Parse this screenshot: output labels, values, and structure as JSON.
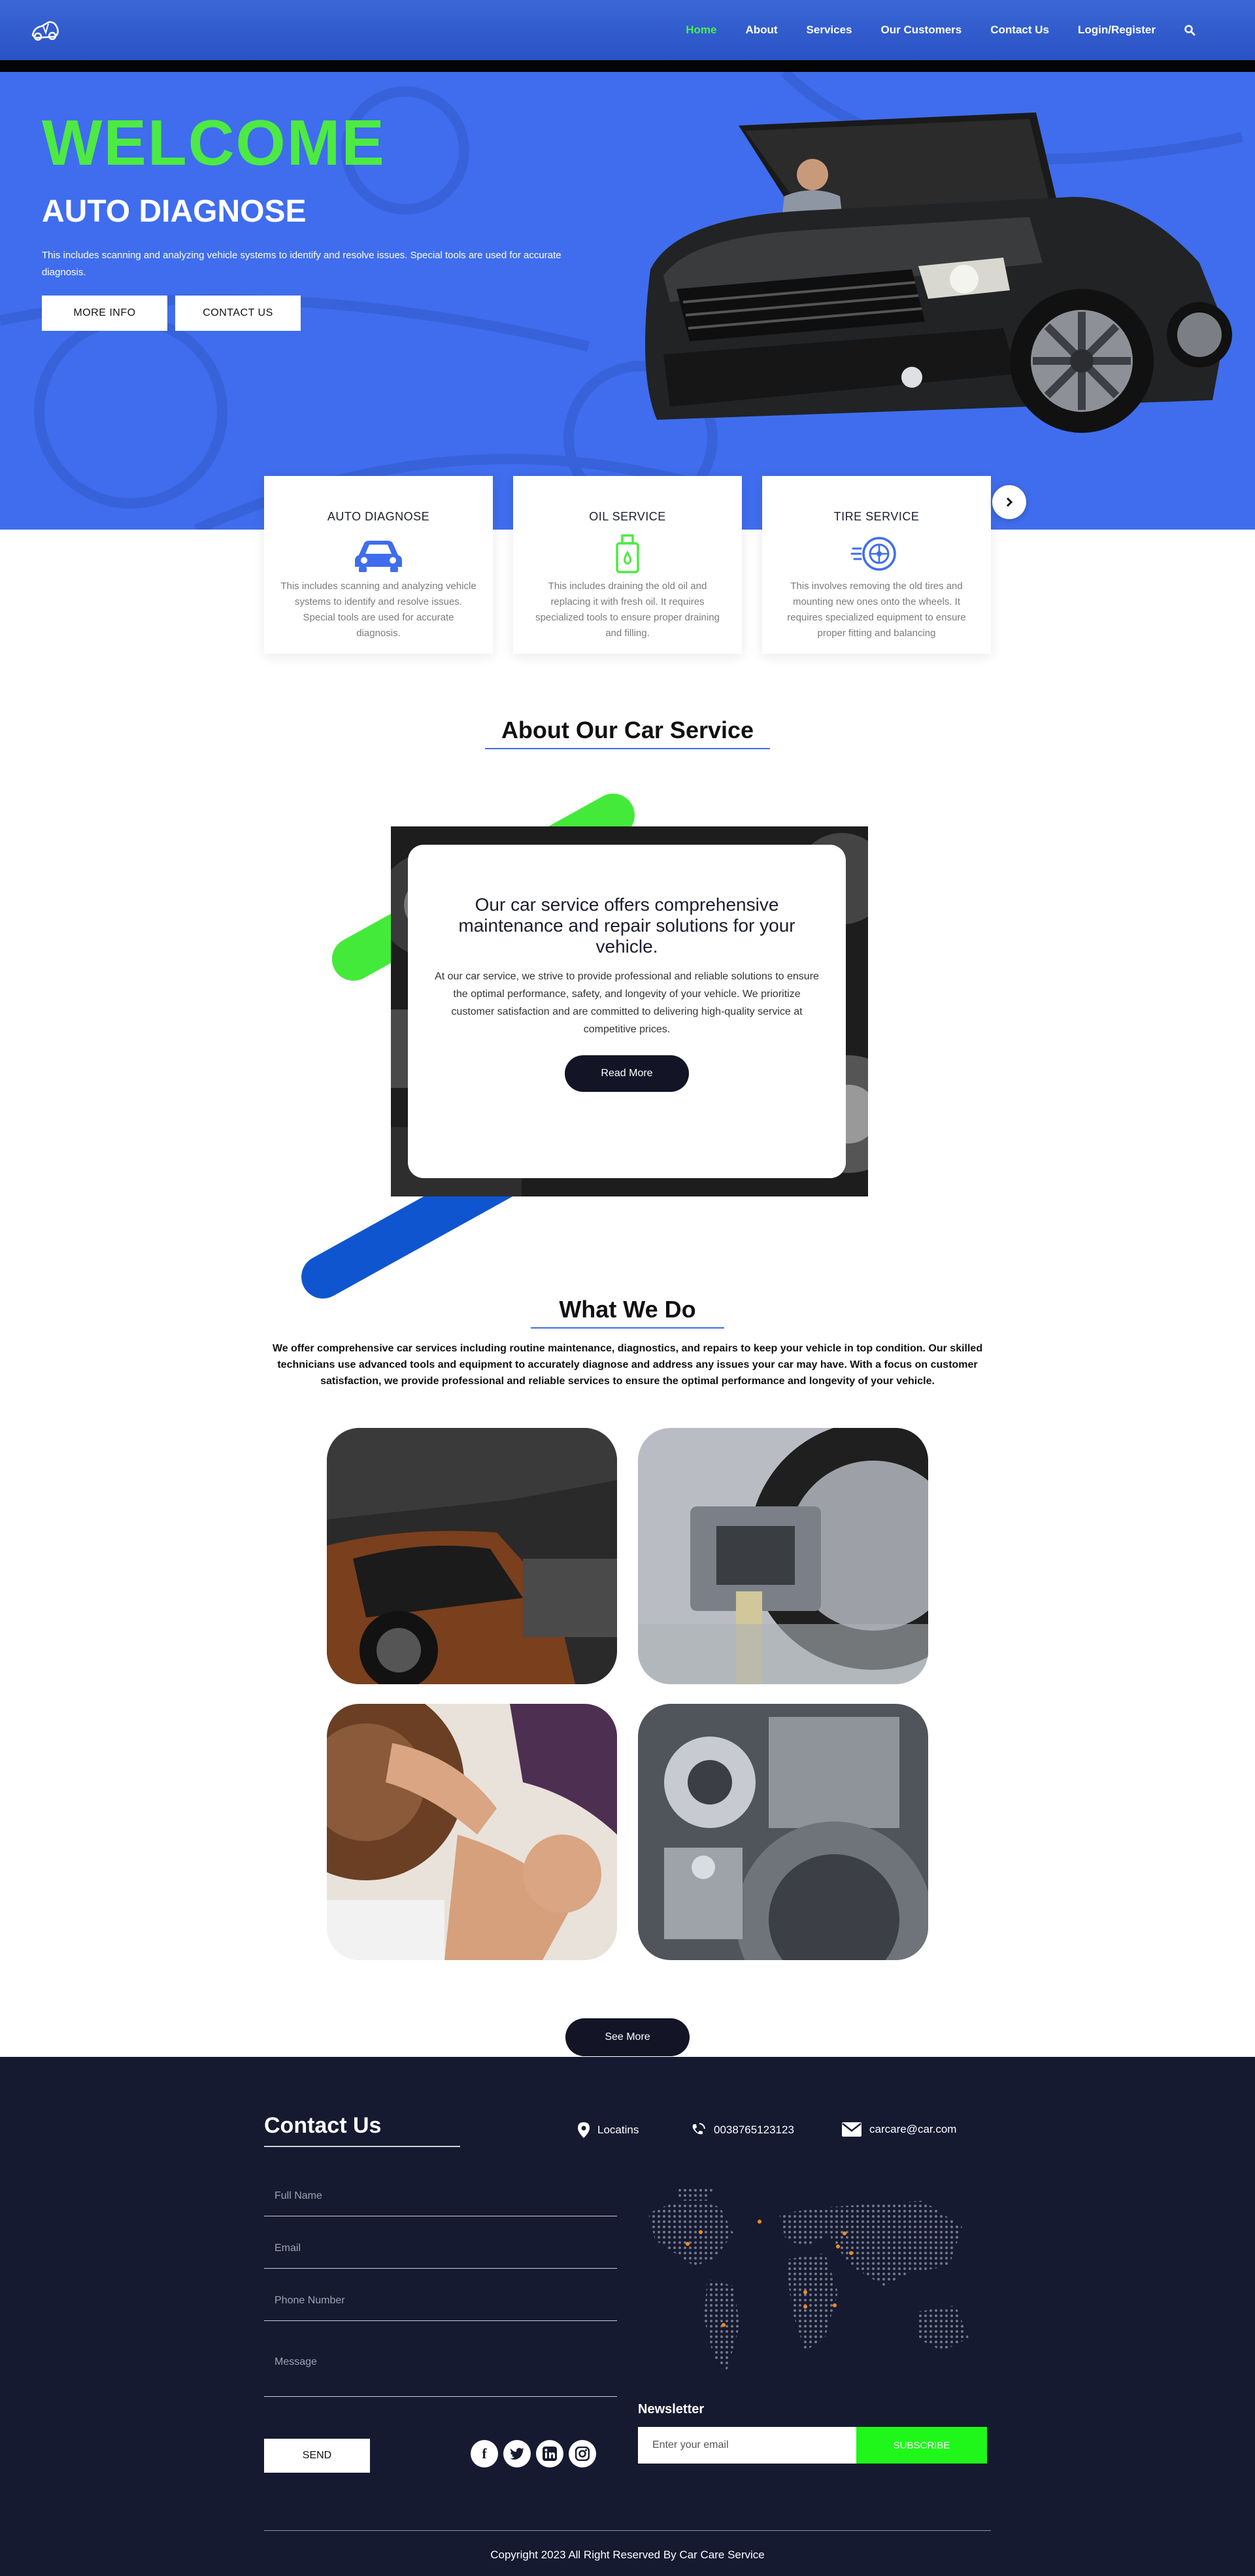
{
  "colors": {
    "primary_blue": "#3f6ded",
    "accent_green": "#45f24a",
    "dark_navy": "#161a30",
    "button_dark": "#131526",
    "subscribe_green": "#1ff71a"
  },
  "header": {
    "logo_icon": "car-logo-icon",
    "nav": [
      {
        "label": "Home",
        "active": true
      },
      {
        "label": "About",
        "active": false
      },
      {
        "label": "Services",
        "active": false
      },
      {
        "label": "Our Customers",
        "active": false
      },
      {
        "label": "Contact Us",
        "active": false
      },
      {
        "label": "Login/Register",
        "active": false
      }
    ],
    "search_icon": "search-icon"
  },
  "hero": {
    "welcome": "WELCOME",
    "title": "AUTO DIAGNOSE",
    "description": "This includes scanning and analyzing vehicle systems to identify and resolve issues. Special tools are used for accurate diagnosis.",
    "more_info_button": "MORE INFO",
    "contact_button": "CONTACT US"
  },
  "services": [
    {
      "title": "AUTO DIAGNOSE",
      "icon": "car-icon",
      "description": "This includes scanning and analyzing vehicle systems to identify and resolve issues. Special tools are used for accurate diagnosis."
    },
    {
      "title": "OIL SERVICE",
      "icon": "oil-can-icon",
      "description": "This includes draining the old oil and replacing it with fresh oil. It requires specialized tools to ensure proper draining and filling."
    },
    {
      "title": "TIRE SERVICE",
      "icon": "tire-icon",
      "description": "This involves removing the old tires and mounting new ones onto the wheels. It requires specialized equipment to ensure proper fitting and balancing"
    }
  ],
  "slider": {
    "next_icon": "chevron-right-icon"
  },
  "about": {
    "heading": "About Our Car Service",
    "card_title": "Our car service offers comprehensive maintenance and repair solutions for your vehicle.",
    "card_text": "At our car service, we strive to provide professional and reliable solutions to ensure the optimal performance, safety, and longevity of your vehicle. We prioritize customer satisfaction and are committed to delivering high-quality service at competitive prices.",
    "button": "Read More"
  },
  "what_we_do": {
    "heading": "What We Do",
    "description": "We offer comprehensive car services including routine maintenance, diagnostics, and repairs to keep your vehicle in top condition. Our skilled technicians use advanced tools and equipment to accurately diagnose and address any issues your car may have. With a focus on customer satisfaction, we provide professional and reliable services to ensure the optimal performance and longevity of your vehicle.",
    "see_more": "See More"
  },
  "footer": {
    "contact_title": "Contact Us",
    "location_label": "Locatins",
    "phone": "0038765123123",
    "email": "carcare@car.com",
    "form": {
      "full_name": "Full Name",
      "email": "Email",
      "phone": "Phone Number",
      "message": "Message",
      "send": "SEND"
    },
    "social": [
      "facebook-icon",
      "twitter-icon",
      "linkedin-icon",
      "instagram-icon"
    ],
    "newsletter": {
      "title": "Newsletter",
      "placeholder": "Enter your email",
      "button": "SUBSCRIBE"
    },
    "copyright": "Copyright 2023 All Right Reserved By Car Care Service"
  }
}
